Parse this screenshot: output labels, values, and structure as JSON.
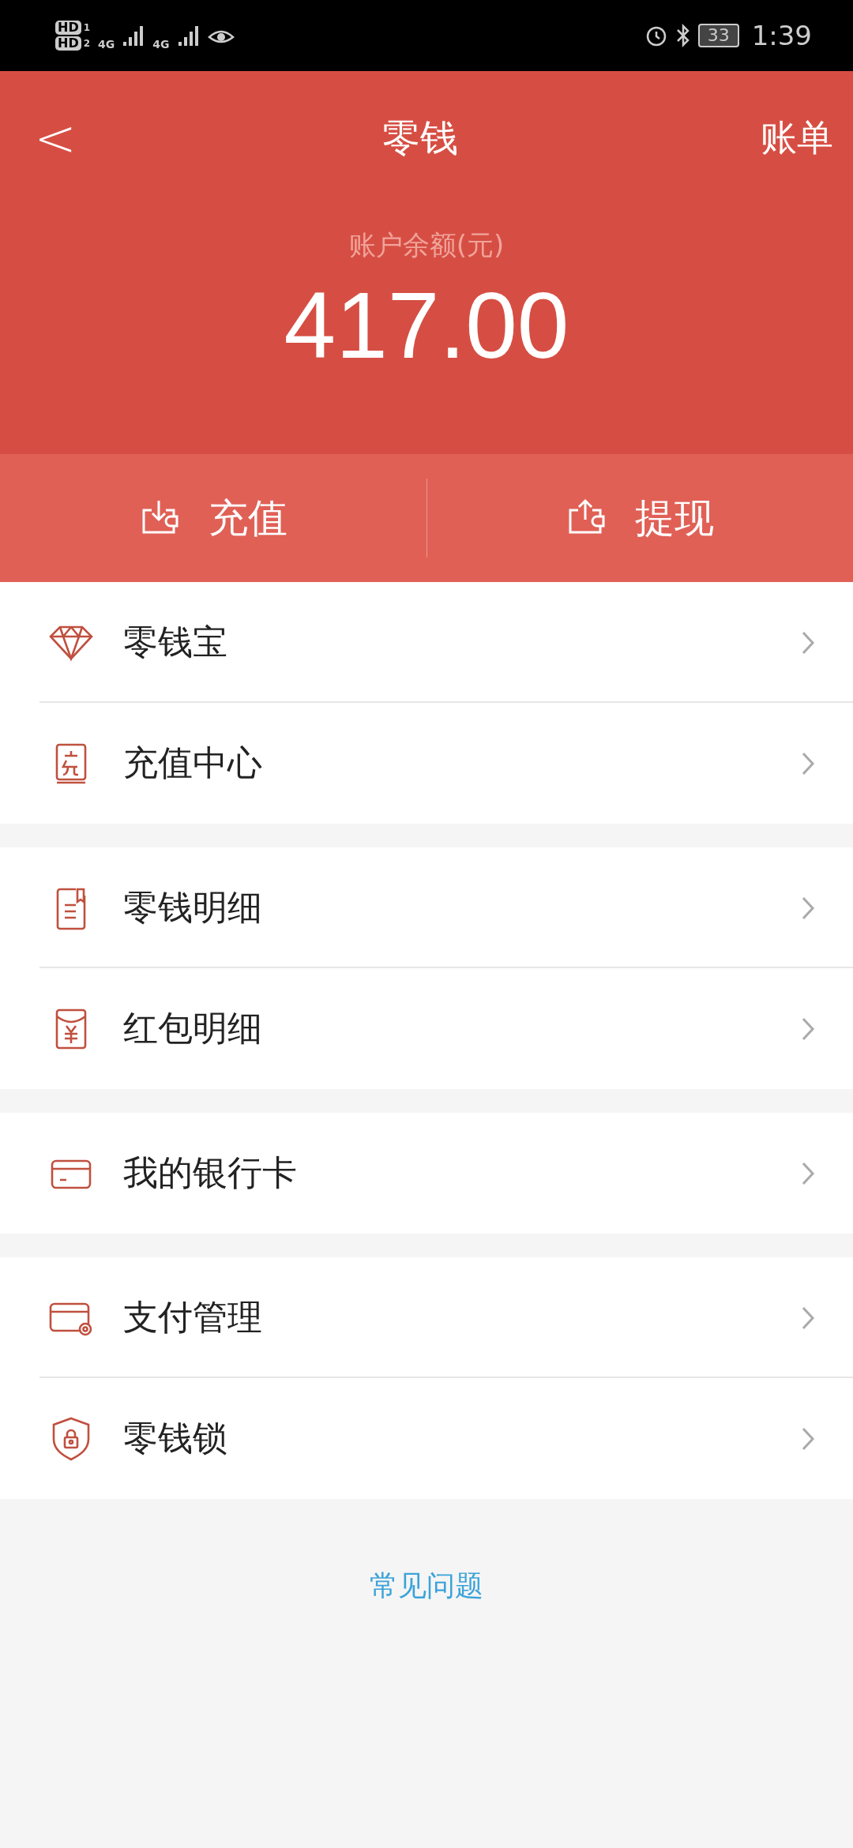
{
  "status_bar": {
    "sims": [
      {
        "badge": "HD",
        "slot": "1",
        "network": "4G"
      },
      {
        "badge": "HD",
        "slot": "2",
        "network": "4G"
      }
    ],
    "battery": "33",
    "time": "1:39"
  },
  "header": {
    "back": "<",
    "title": "零钱",
    "action": "账单"
  },
  "balance": {
    "label": "账户余额(元)",
    "amount": "417.00"
  },
  "actions": [
    {
      "kind": "deposit",
      "label": "充值"
    },
    {
      "kind": "withdraw",
      "label": "提现"
    }
  ],
  "groups": [
    [
      {
        "kind": "diamond",
        "label": "零钱宝"
      },
      {
        "kind": "recharge",
        "label": "充值中心"
      }
    ],
    [
      {
        "kind": "document",
        "label": "零钱明细"
      },
      {
        "kind": "packet",
        "label": "红包明细"
      }
    ],
    [
      {
        "kind": "card",
        "label": "我的银行卡"
      }
    ],
    [
      {
        "kind": "card-gear",
        "label": "支付管理"
      },
      {
        "kind": "shield",
        "label": "零钱锁"
      }
    ]
  ],
  "faq": "常见问题"
}
